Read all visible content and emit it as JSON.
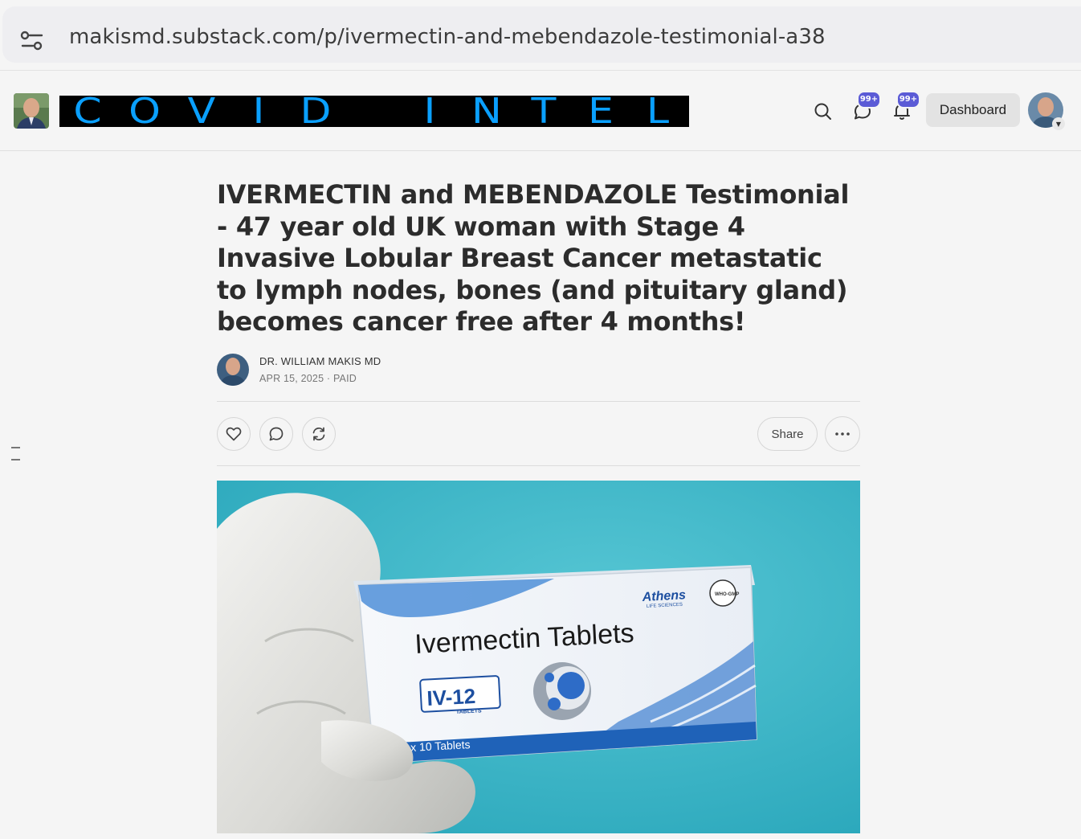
{
  "browser": {
    "url": "makismd.substack.com/p/ivermectin-and-mebendazole-testimonial-a38"
  },
  "header": {
    "wordmark_letters": [
      "C",
      "O",
      "V",
      "I",
      "D",
      "",
      "I",
      "N",
      "T",
      "E",
      "L"
    ],
    "wordmark_alt": "COVID INTEL",
    "chat_badge": "99+",
    "notif_badge": "99+",
    "dashboard_label": "Dashboard",
    "colors": {
      "wordmark_text": "#0aa0ff",
      "badge": "#5b5bd6"
    }
  },
  "article": {
    "title": "IVERMECTIN and MEBENDAZOLE Testimonial - 47 year old UK woman with Stage 4 Invasive Lobular Breast Cancer metastatic to lymph nodes, bones (and pituitary gland) becomes cancer free after 4 months!",
    "author": "DR. WILLIAM MAKIS MD",
    "meta": "APR 15, 2025 · PAID",
    "share_label": "Share"
  },
  "hero_image": {
    "box_title": "Ivermectin Tablets",
    "brand": "Athens",
    "brand_sub": "LIFE SCIENCES",
    "product_code": "IV-12",
    "product_sub": "TABLETS",
    "count": "10 x 10 Tablets",
    "seal": "WHO-GMP"
  }
}
